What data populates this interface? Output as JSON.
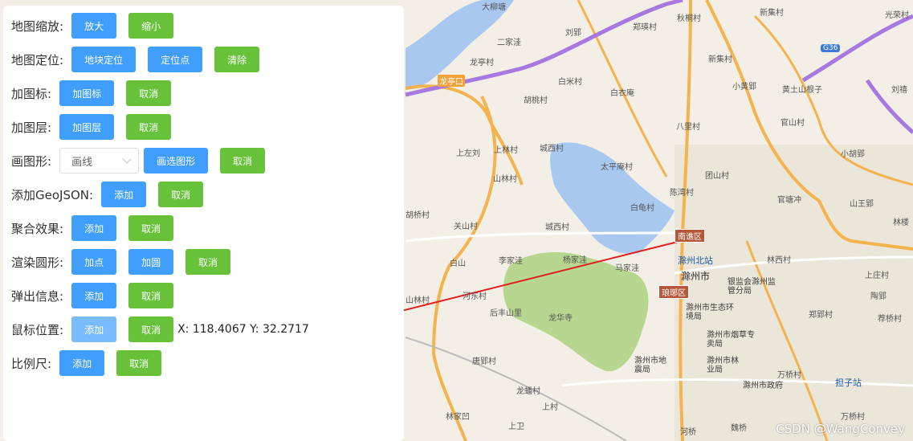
{
  "panel": {
    "rows": [
      {
        "label": "地图缩放:",
        "buttons": [
          "放大",
          "缩小"
        ]
      },
      {
        "label": "地图定位:",
        "buttons": [
          "地块定位",
          "定位点",
          "清除"
        ]
      },
      {
        "label": "加图标:",
        "buttons": [
          "加图标",
          "取消"
        ]
      },
      {
        "label": "加图层:",
        "buttons": [
          "加图层",
          "取消"
        ]
      },
      {
        "label": "画图形:",
        "select": "画线",
        "buttons": [
          "画选图形",
          "取消"
        ]
      },
      {
        "label": "添加GeoJSON:",
        "buttons": [
          "添加",
          "取消"
        ]
      },
      {
        "label": "聚合效果:",
        "buttons": [
          "添加",
          "取消"
        ]
      },
      {
        "label": "渲染圆形:",
        "buttons": [
          "加点",
          "加圆",
          "取消"
        ]
      },
      {
        "label": "弹出信息:",
        "buttons": [
          "添加",
          "取消"
        ]
      },
      {
        "label": "鼠标位置:",
        "buttons": [
          "添加",
          "取消"
        ],
        "readout": "X: 118.4067  Y: 32.2717"
      },
      {
        "label": "比例尺:",
        "buttons": [
          "添加",
          "取消"
        ]
      }
    ]
  },
  "map": {
    "labels": {
      "taliu": "大柳塘",
      "erjiawa": "二家洼",
      "liuying": "刘郢",
      "zhenggongcun": "郑瑛村",
      "qiucun": "秋桐村",
      "xinji": "新集村",
      "guanghua": "光荣村",
      "longtingcun": "龙亭村",
      "longtingkou": "龙亭口",
      "baimi": "白米村",
      "baiyian": "白衣庵",
      "xinjicun2": "新集村",
      "xiaohuang": "小黄郢",
      "huangtu": "黄土山根子",
      "liuhuo": "刘禧",
      "hutao": "胡桃村",
      "baili": "八里村",
      "guanshan": "官山村",
      "shangzuo": "上左刘",
      "shanglin": "上林村",
      "chengxi": "城西村",
      "xiaohu": "小胡郢",
      "taipingan": "太平庵村",
      "tuanshan": "团山村",
      "shanlin": "山林村",
      "chenwan": "陈湾村",
      "guantang": "官塘冲",
      "shanwang": "山王郢",
      "hutou": "胡桥村",
      "guanshan2": "关山村",
      "baigui": "白龟村",
      "chengxi2": "城西村",
      "linqiao": "林楼",
      "guanshancun": "关山村",
      "lijiawa": "李家洼",
      "yangjiawa": "杨家洼",
      "majiawa": "马家洼",
      "baishang": "白山",
      "chuzhoubeizhan": "滁州北站",
      "chuzhoushi": "滁州市",
      "linxi": "林西村",
      "shangzhuang": "上庄村",
      "hedong": "河东村",
      "shanlincun": "山林村",
      "houfeng": "后丰山里",
      "longhua": "龙华寺",
      "jianguan": "银监会滁州监管分局",
      "shengtai": "滁州市生态环境局",
      "yancao": "滁州市烟草专卖局",
      "zhengfu": "滁州市政府",
      "dizhen": "滁州市地震局",
      "linye": "滁州市林业局",
      "wanqiao": "万桥村",
      "dongzi": "担子站",
      "zhengcun": "郑郢村",
      "taiqiao": "荐桥村",
      "taoying": "陶郢",
      "tangying": "唐郢村",
      "longfan": "龙蟠村",
      "shangcun": "上村",
      "linjia": "林家凹",
      "shangwei": "上卫",
      "hexi": "河桥",
      "xiawan": "魏桥",
      "wanqiao2": "万桥村"
    },
    "road_tags": {
      "g36": "G36"
    },
    "district_tags": {
      "nanqiao": "南谯区",
      "langya": "琅琊区"
    },
    "watermark": "CSDN @WangConvey"
  },
  "colors": {
    "primary": "#409eff",
    "success": "#67c23a",
    "arrow": "#e11d1d"
  }
}
